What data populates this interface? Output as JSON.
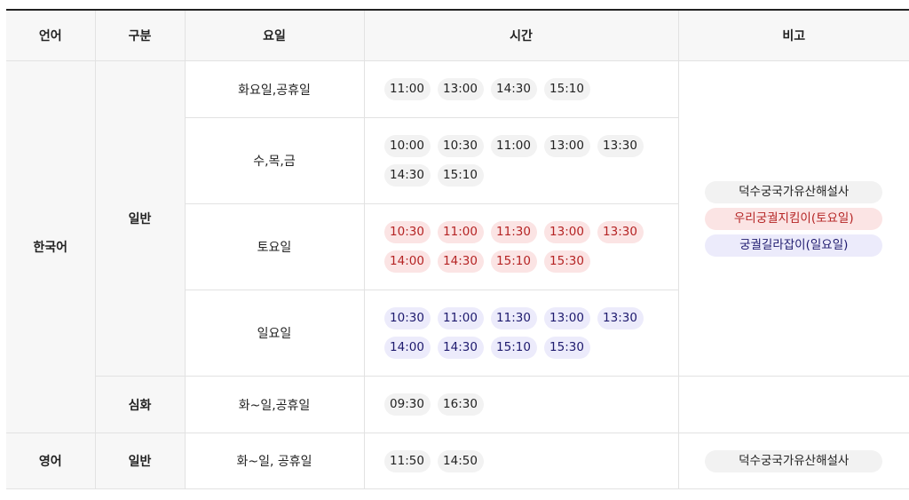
{
  "headers": [
    "언어",
    "구분",
    "요일",
    "시간",
    "비고"
  ],
  "korean": {
    "language": "한국어",
    "general": {
      "category": "일반",
      "rows": [
        {
          "days": "화요일,공휴일",
          "times": [
            "11:00",
            "13:00",
            "14:30",
            "15:10"
          ]
        },
        {
          "days": "수,목,금",
          "times": [
            "10:00",
            "10:30",
            "11:00",
            "13:00",
            "13:30",
            "14:30",
            "15:10"
          ]
        },
        {
          "days": "토요일",
          "times": [
            "10:30",
            "11:00",
            "11:30",
            "13:00",
            "13:30",
            "14:00",
            "14:30",
            "15:10",
            "15:30"
          ]
        },
        {
          "days": "일요일",
          "times": [
            "10:30",
            "11:00",
            "11:30",
            "13:00",
            "13:30",
            "14:00",
            "14:30",
            "15:10",
            "15:30"
          ]
        }
      ],
      "notes": [
        "덕수궁국가유산해설사",
        "우리궁궐지킴이(토요일)",
        "궁궐길라잡이(일요일)"
      ]
    },
    "advanced": {
      "category": "심화",
      "days": "화~일,공휴일",
      "times": [
        "09:30",
        "16:30"
      ],
      "note": ""
    }
  },
  "english": {
    "language": "영어",
    "category": "일반",
    "days": "화~일, 공휴일",
    "times": [
      "11:50",
      "14:50"
    ],
    "note": "덕수궁국가유산해설사"
  },
  "colors": {
    "saturday_bg": "#fbe4e4",
    "saturday_text": "#b52424",
    "sunday_bg": "#ecebfb",
    "sunday_text": "#1e1a6e",
    "default_bg": "#f2f2f2"
  }
}
